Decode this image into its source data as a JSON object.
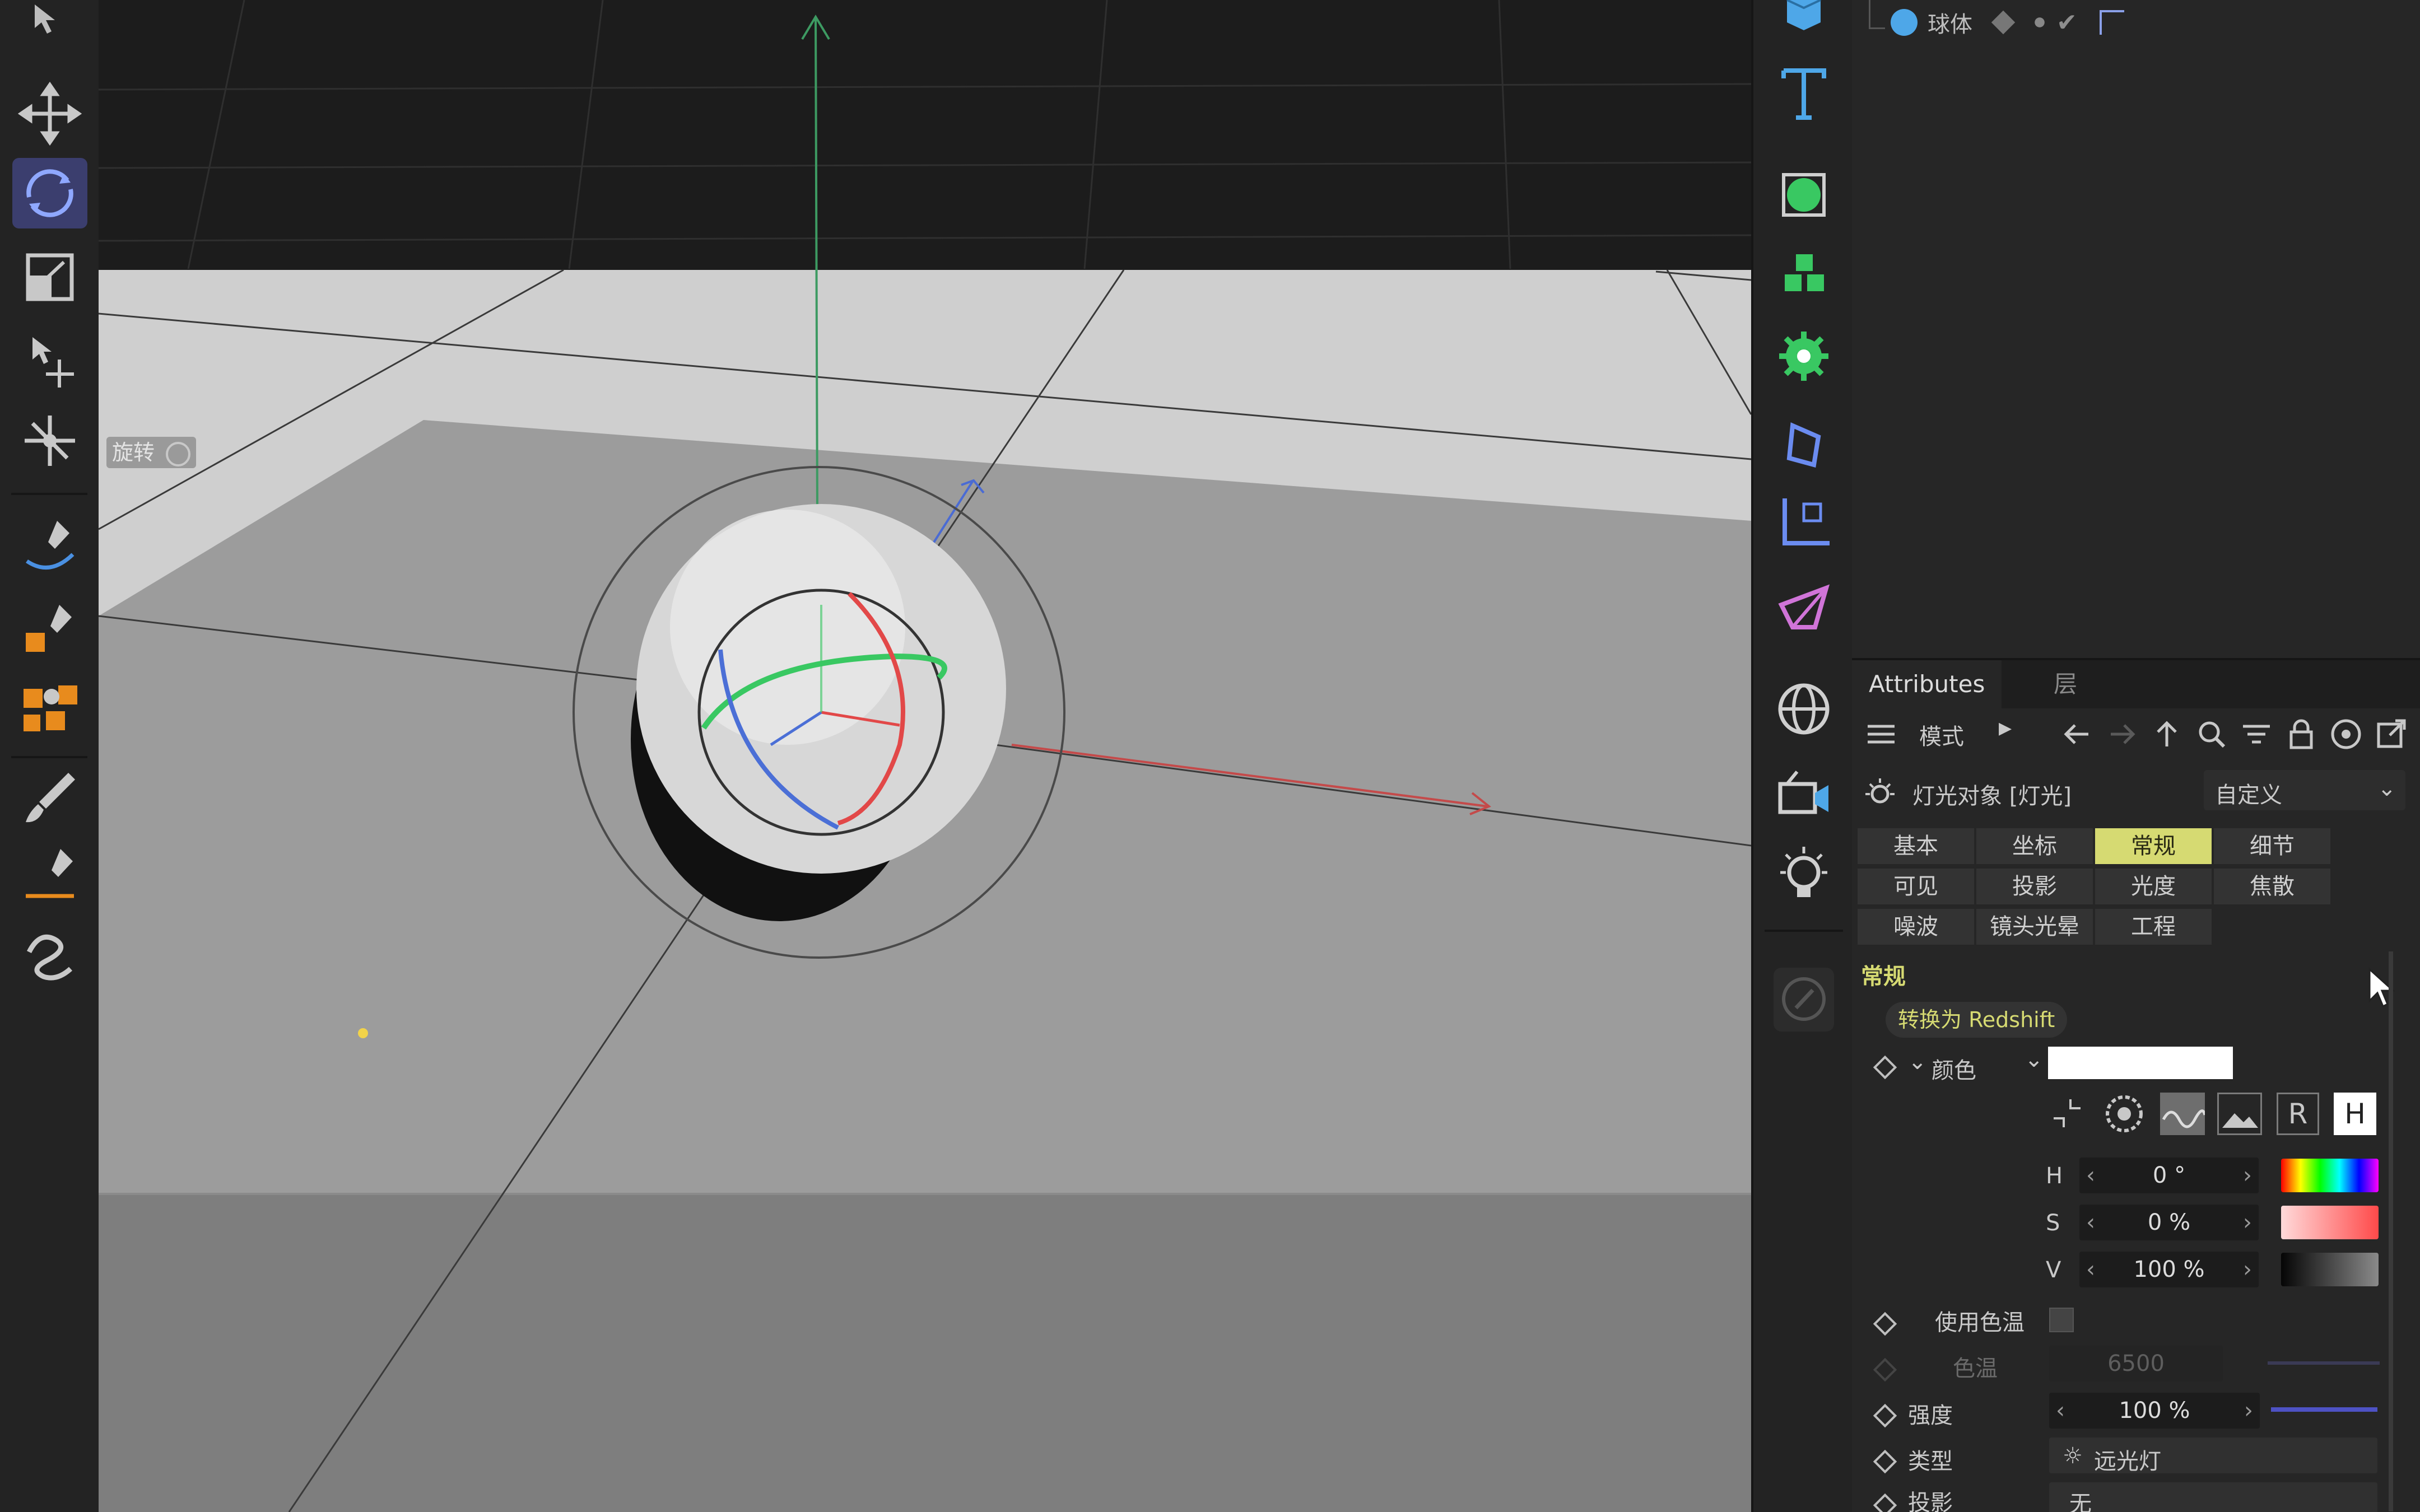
{
  "viewport": {
    "label": "旋转"
  },
  "object_manager": {
    "object_name": "球体"
  },
  "attributes": {
    "tabs": [
      "Attributes",
      "层"
    ],
    "toolbar": {
      "mode_label": "模式"
    },
    "header": {
      "title": "灯光对象 [灯光]",
      "preset": "自定义"
    },
    "prop_tabs": [
      [
        "基本",
        "坐标",
        "常规",
        "细节"
      ],
      [
        "可见",
        "投影",
        "光度",
        "焦散"
      ],
      [
        "噪波",
        "镜头光晕",
        "工程"
      ]
    ],
    "selected_tab": "常规",
    "section_title": "常规",
    "convert_button": "转换为 Redshift",
    "color_label": "颜色",
    "color_mode_buttons": [
      "R",
      "H"
    ],
    "hsv": [
      {
        "label": "H",
        "value": "0 °"
      },
      {
        "label": "S",
        "value": "0 %"
      },
      {
        "label": "V",
        "value": "100 %"
      }
    ],
    "use_temperature_label": "使用色温",
    "temperature_label": "色温",
    "temperature_value": "6500",
    "intensity_label": "强度",
    "intensity_value": "100 %",
    "type_label": "类型",
    "type_value": "远光灯",
    "shadow_label": "投影",
    "shadow_value": "无"
  },
  "colors": {
    "accent": "#d6da72",
    "active_tool": "#3b3e6e",
    "axis_x": "#e24848",
    "axis_y": "#3cc060",
    "axis_z": "#4b6fd6"
  }
}
